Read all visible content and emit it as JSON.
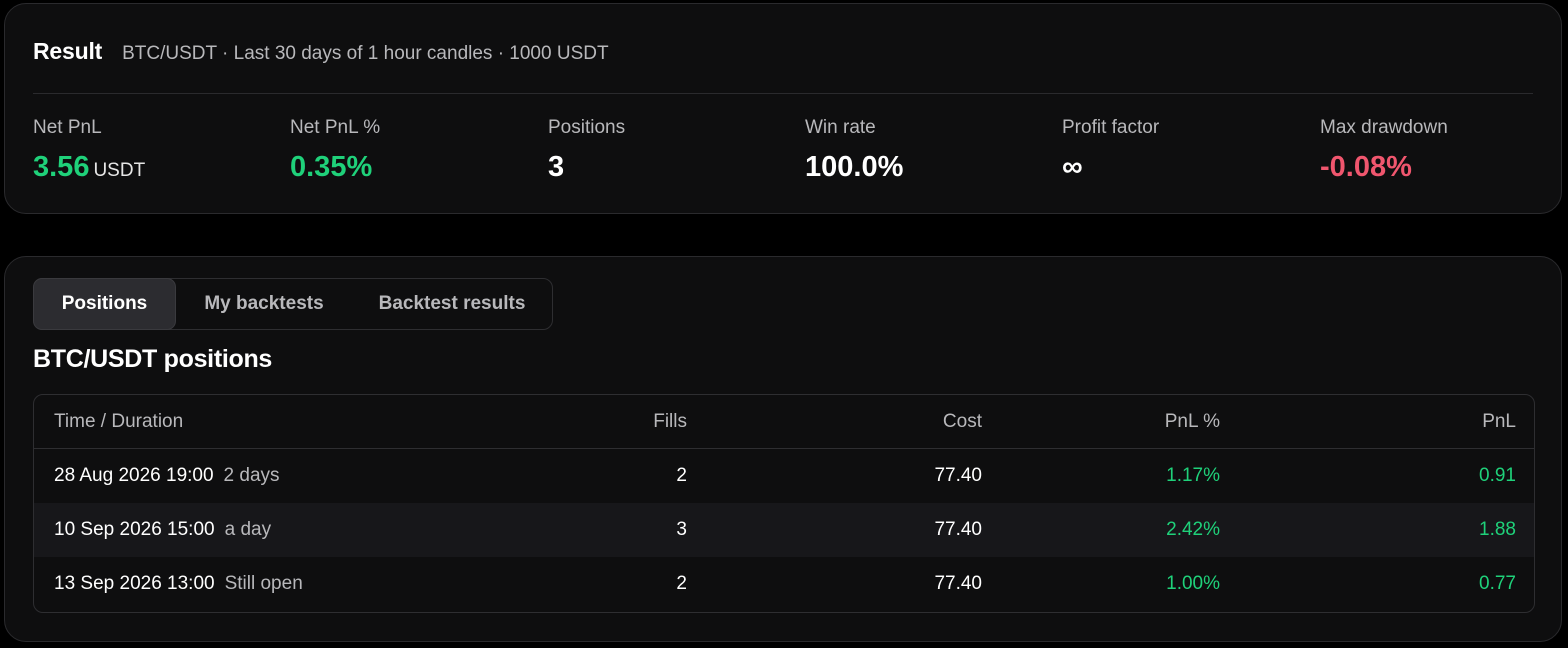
{
  "result": {
    "title": "Result",
    "subtitle": "BTC/USDT · Last 30 days of 1 hour candles · 1000 USDT",
    "stats": {
      "net_pnl": {
        "label": "Net PnL",
        "value": "3.56",
        "unit": "USDT"
      },
      "net_pnl_pct": {
        "label": "Net PnL %",
        "value": "0.35%"
      },
      "positions": {
        "label": "Positions",
        "value": "3"
      },
      "win_rate": {
        "label": "Win rate",
        "value": "100.0%"
      },
      "profit_factor": {
        "label": "Profit factor",
        "value": "∞"
      },
      "max_drawdown": {
        "label": "Max drawdown",
        "value": "-0.08%"
      }
    }
  },
  "tabs": {
    "positions": "Positions",
    "my_backtests": "My backtests",
    "backtest_results": "Backtest results",
    "active": "positions"
  },
  "positions": {
    "title": "BTC/USDT positions",
    "columns": {
      "time": "Time / Duration",
      "fills": "Fills",
      "cost": "Cost",
      "pnl_pct": "PnL %",
      "pnl": "PnL"
    },
    "rows": [
      {
        "time": "28 Aug 2026 19:00",
        "duration": "2 days",
        "fills": "2",
        "cost": "77.40",
        "pnl_pct": "1.17%",
        "pnl": "0.91"
      },
      {
        "time": "10 Sep 2026 15:00",
        "duration": "a day",
        "fills": "3",
        "cost": "77.40",
        "pnl_pct": "2.42%",
        "pnl": "1.88"
      },
      {
        "time": "13 Sep 2026 13:00",
        "duration": "Still open",
        "fills": "2",
        "cost": "77.40",
        "pnl_pct": "1.00%",
        "pnl": "0.77"
      }
    ]
  },
  "colors": {
    "positive": "#1fd17a",
    "negative": "#f0566e",
    "background": "#000000",
    "card": "#0e0e0f"
  }
}
